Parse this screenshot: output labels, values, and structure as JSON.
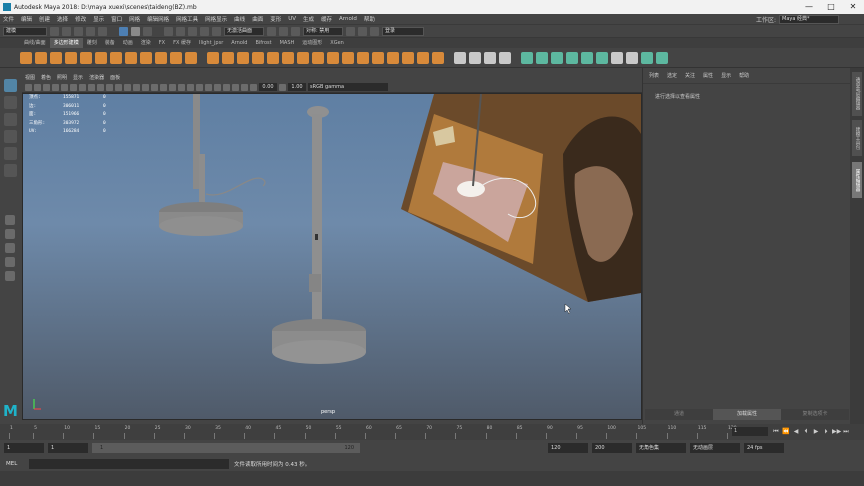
{
  "window": {
    "title": "Autodesk Maya 2018: D:\\maya xuexi\\scenes\\taideng(BZ).mb",
    "minimize": "—",
    "maximize": "□",
    "close": "✕"
  },
  "menubar": {
    "items": [
      "文件",
      "编辑",
      "创建",
      "选择",
      "修改",
      "显示",
      "窗口",
      "网格",
      "编辑网格",
      "网格工具",
      "网格显示",
      "曲线",
      "曲面",
      "变形",
      "UV",
      "生成",
      "缓存",
      "Arnold",
      "帮助"
    ],
    "workspace_label": "工作区:",
    "workspace_value": "Maya 经典*"
  },
  "statusline": {
    "mode": "建模",
    "live_surface": "无激活曲面",
    "symmetry": "对称: 禁用",
    "login": "登录"
  },
  "shelf_tabs": [
    "曲线/曲面",
    "多边形建模",
    "雕刻",
    "装备",
    "动画",
    "渲染",
    "FX",
    "FX 缓存",
    "Ilight_jpsr",
    "Arnold",
    "Bifrost",
    "MASH",
    "运动图形",
    "XGen"
  ],
  "shelf_active_tab": "多边形建模",
  "viewport": {
    "menu": [
      "视图",
      "着色",
      "照明",
      "显示",
      "渲染器",
      "面板"
    ],
    "exposure": "0.00",
    "gamma": "1.00",
    "color_space": "sRGB gamma",
    "camera": "persp",
    "hud": [
      [
        "顶点:",
        "155871",
        "0"
      ],
      [
        "边:",
        "306011",
        "0"
      ],
      [
        "面:",
        "151966",
        "0"
      ],
      [
        "三角形:",
        "303972",
        "0"
      ],
      [
        "UV:",
        "166284",
        "0"
      ]
    ]
  },
  "channel_box": {
    "menu": [
      "列表",
      "选定",
      "关注",
      "属性",
      "显示",
      "帮助"
    ],
    "message": "进行选择以查看属性",
    "tabs": [
      "通道",
      "加载属性",
      "复制选项卡"
    ],
    "active_tab": "加载属性"
  },
  "side_tabs": [
    "通道盒/层编辑器",
    "建模工具包",
    "属性编辑器"
  ],
  "timeline": {
    "ticks": [
      "1",
      "5",
      "10",
      "15",
      "20",
      "25",
      "30",
      "35",
      "40",
      "45",
      "50",
      "55",
      "60",
      "65",
      "70",
      "75",
      "80",
      "85",
      "90",
      "95",
      "100",
      "105",
      "110",
      "115",
      "120"
    ],
    "current_frame": "1",
    "playback_buttons": [
      "⏮",
      "⏪",
      "◀",
      "⏴",
      "▶",
      "⏵",
      "▶▶",
      "⏭"
    ]
  },
  "range": {
    "start": "1",
    "inner_start": "1",
    "slider_start": "1",
    "slider_end": "120",
    "end": "120",
    "outer_end": "200",
    "character_set": "无角色集",
    "anim_layer": "无动画层",
    "fps": "24 fps"
  },
  "command": {
    "label": "MEL",
    "result": "文件读取所用时间为 0.43 秒。"
  }
}
